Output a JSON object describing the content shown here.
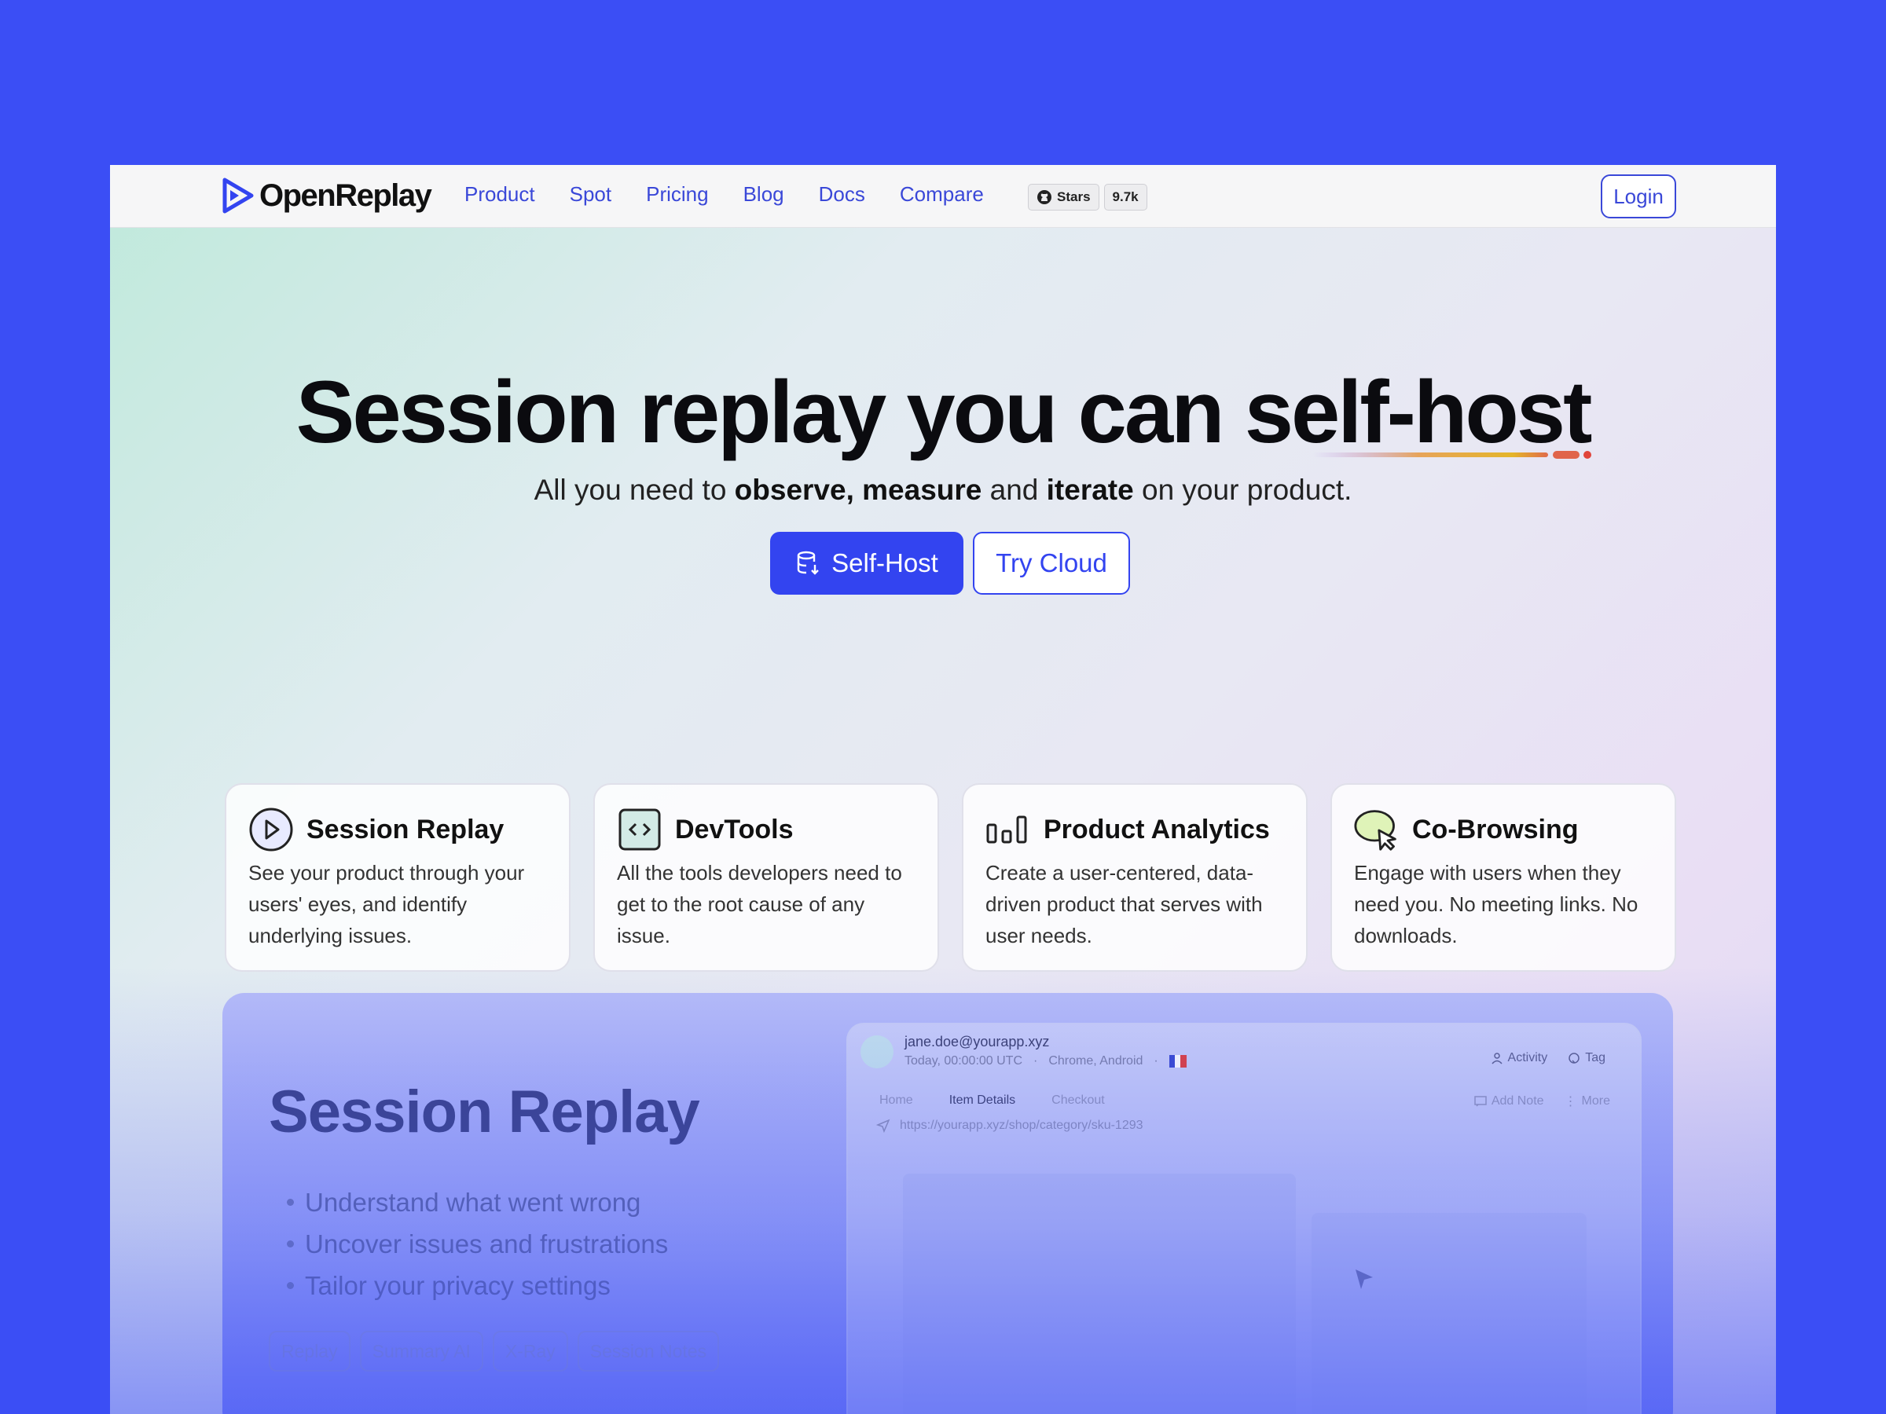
{
  "brand": {
    "name": "OpenReplay"
  },
  "nav": {
    "items": [
      {
        "label": "Product"
      },
      {
        "label": "Spot"
      },
      {
        "label": "Pricing"
      },
      {
        "label": "Blog"
      },
      {
        "label": "Docs"
      },
      {
        "label": "Compare"
      }
    ],
    "github": {
      "stars_label": "Stars",
      "count": "9.7k"
    },
    "login_label": "Login"
  },
  "hero": {
    "title": "Session replay you can self-host",
    "subtitle_parts": [
      "All you need to ",
      "observe, measure",
      " and ",
      "iterate",
      " on your product."
    ],
    "primary_cta": "Self-Host",
    "secondary_cta": "Try Cloud",
    "accent_color": "#3344f0"
  },
  "features": [
    {
      "title": "Session Replay",
      "desc": "See your product through your users' eyes, and identify underlying issues.",
      "icon": "play-circle-icon"
    },
    {
      "title": "DevTools",
      "desc": "All the tools developers need to get to the root cause of any issue.",
      "icon": "code-icon"
    },
    {
      "title": "Product Analytics",
      "desc": "Create a user-centered, data-driven product that serves with user needs.",
      "icon": "bar-chart-icon"
    },
    {
      "title": "Co-Browsing",
      "desc": "Engage with users when they need you. No meeting links. No downloads.",
      "icon": "cursor-bubble-icon"
    }
  ],
  "showcase": {
    "title": "Session Replay",
    "bullets": [
      "Understand what went wrong",
      "Uncover issues and frustrations",
      "Tailor your privacy settings"
    ],
    "chips": [
      "Replay",
      "Summary AI",
      "X-Ray",
      "Session Notes"
    ],
    "mock": {
      "user": "jane.doe@yourapp.xyz",
      "time": "Today, 00:00:00 UTC",
      "device": "Chrome, Android",
      "activity": "Activity",
      "tag": "Tag",
      "tabs": [
        "Home",
        "Item Details",
        "Checkout"
      ],
      "add_note": "Add Note",
      "more": "More",
      "url": "https://yourapp.xyz/shop/category/sku-1293"
    }
  }
}
